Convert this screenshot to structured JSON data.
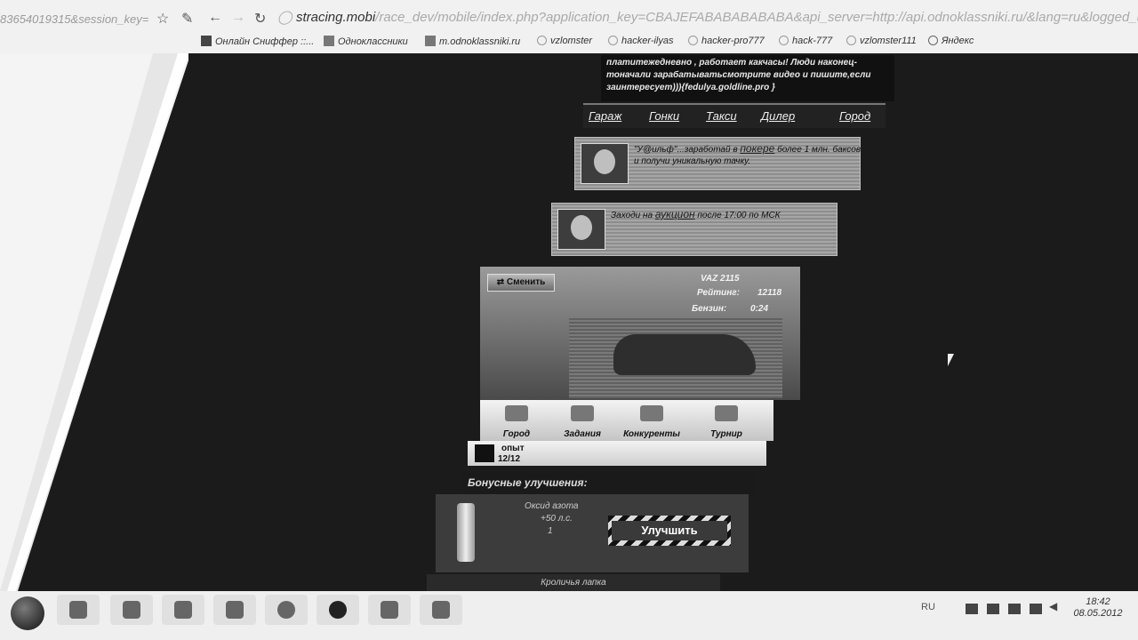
{
  "browser": {
    "address_left": "83654019315&session_key=",
    "url_domain": "stracing.mobi",
    "url_rest": "/race_dev/mobile/index.php?application_key=CBAJEFABABABABABA&api_server=http://api.odnoklassniki.ru/&lang=ru&logged_user_id=",
    "bookmarks": [
      "Онлайн Сниффер ::...",
      "Одноклассники",
      "m.odnoklassniki.ru",
      "vzlomster",
      "hacker-ilyas",
      "hacker-pro777",
      "hack-777",
      "vzlomster111",
      "Яндекс"
    ]
  },
  "game": {
    "promo_text": "платитежедневно , работает какчасы! Люди наконец-тоначали зарабатыватьсмотрите видео и пишите,если заинтересует))){fedulya.goldline.pro }",
    "nav": [
      "Гараж",
      "Гонки",
      "Такси",
      "Дилер",
      "Город"
    ],
    "news": [
      {
        "before": "\"У@ильф\"...заработай в",
        "link": "покере",
        "after": "более 1 млн. баксов и получи уникальную тачку."
      },
      {
        "before": "Заходи на",
        "link": "аукцион",
        "after": "после 17:00 по МСК"
      }
    ],
    "swap_button": "Сменить",
    "car": {
      "model": "VAZ 2115",
      "rating_label": "Рейтинг:",
      "rating_value": "12118",
      "fuel_label": "Бензин:",
      "fuel_value": "0:24"
    },
    "menu": [
      "Город",
      "Задания",
      "Конкуренты",
      "Турнир"
    ],
    "exp_label": "опыт",
    "exp_value": "12/12",
    "bonus_title": "Бонусные улучшения:",
    "bonus": {
      "name": "Оксид азота",
      "stat": "+50 л.с.",
      "count": "1",
      "button": "Улучшить"
    },
    "next_item": "Кроличья лапка"
  },
  "taskbar": {
    "lang": "RU",
    "time": "18:42",
    "date": "08.05.2012"
  }
}
